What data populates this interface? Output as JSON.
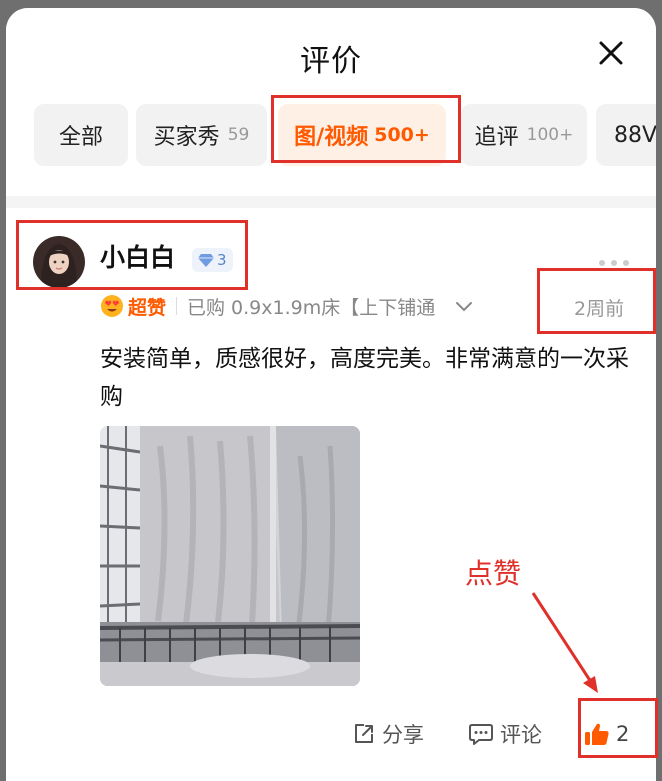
{
  "sheet": {
    "title": "评价"
  },
  "tabs": [
    {
      "label": "全部",
      "count": ""
    },
    {
      "label": "买家秀",
      "count": "59"
    },
    {
      "label": "图/视频",
      "count": "500+"
    },
    {
      "label": "追评",
      "count": "100+"
    },
    {
      "label": "88V",
      "count": ""
    }
  ],
  "review": {
    "username": "小白白",
    "level": "3",
    "badge": "超赞",
    "purchase": "已购 0.9x1.9m床【上下铺通",
    "time": "2周前",
    "content": "安装简单，质感很好，高度完美。非常满意的一次采购",
    "actions": {
      "share": "分享",
      "comment": "评论",
      "like_count": "2"
    }
  },
  "annotation": {
    "label": "点赞"
  },
  "colors": {
    "accent": "#ff5a00",
    "annotation": "#e0302a",
    "level": "#5a85c8"
  },
  "icons": [
    "close-icon",
    "diamond-icon",
    "more-icon",
    "heart-eyes-icon",
    "chevron-down-icon",
    "share-icon",
    "comment-icon",
    "thumbs-up-icon"
  ]
}
